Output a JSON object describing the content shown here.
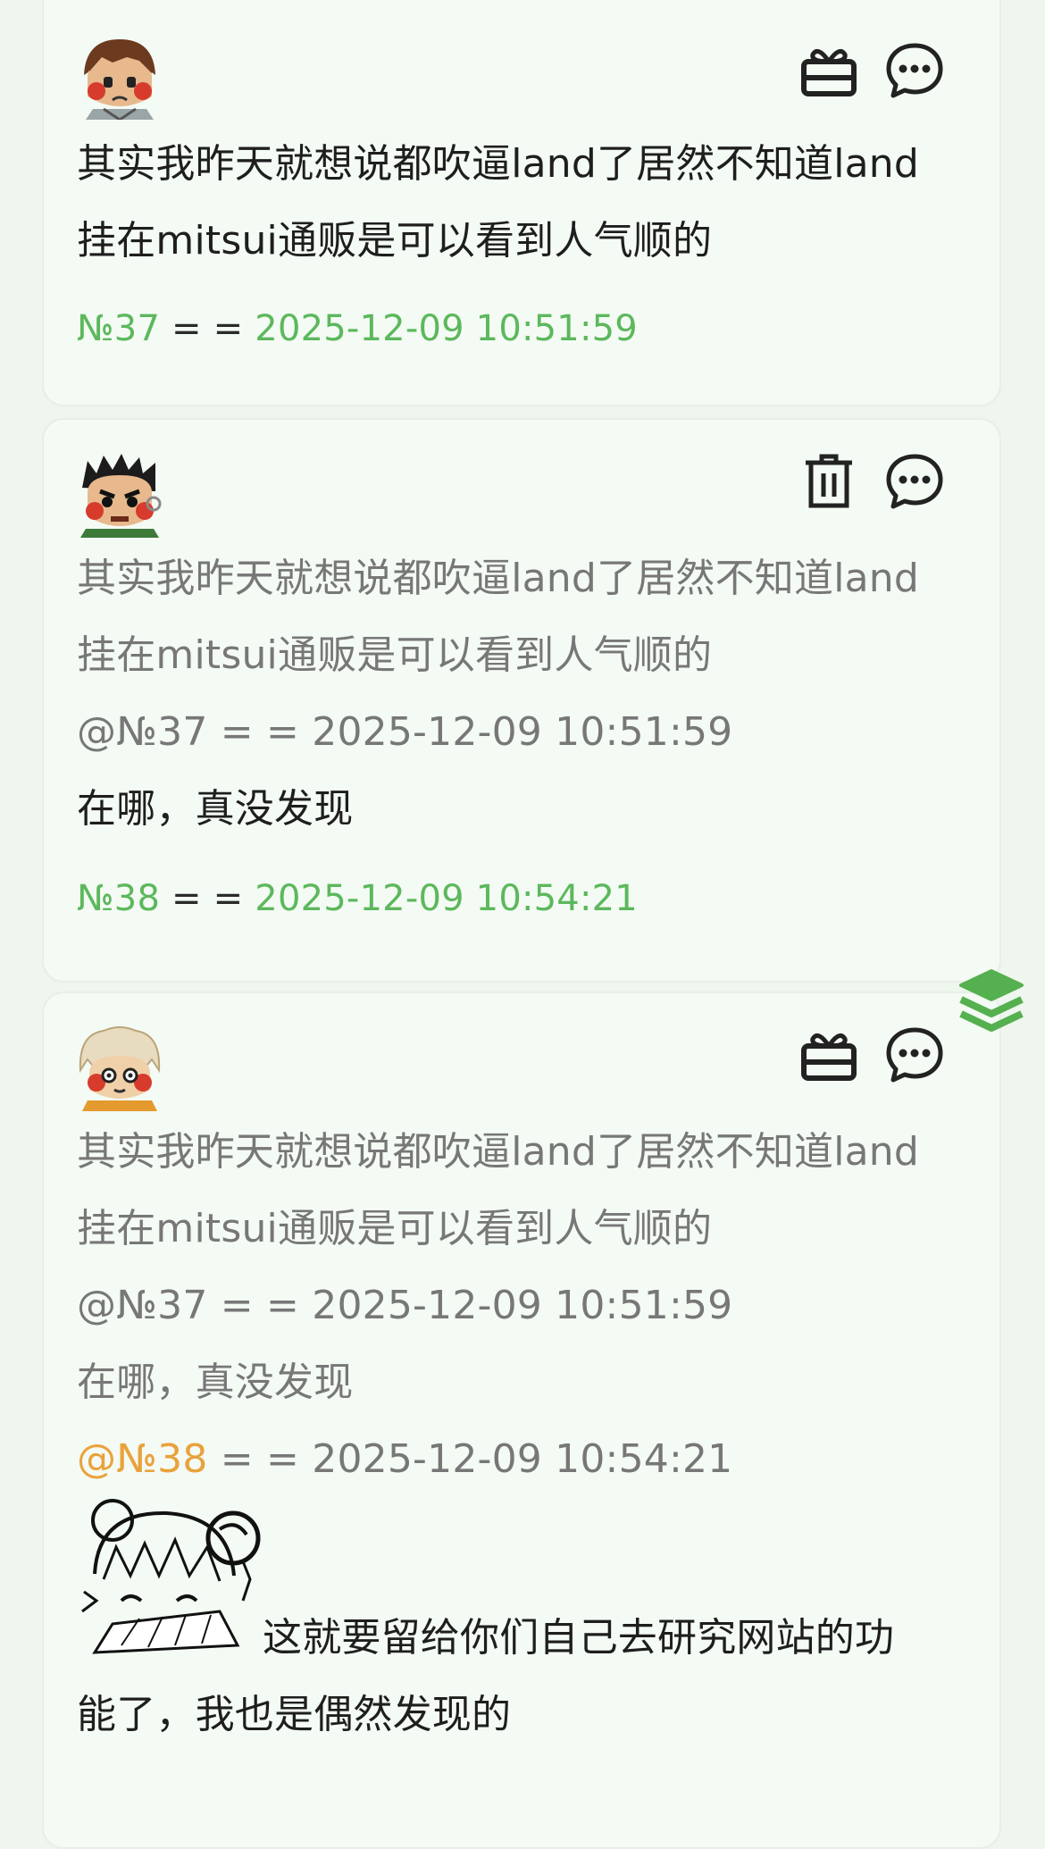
{
  "comments": [
    {
      "lines": [
        "其实我昨天就想说都吹逼land了居然不知道land",
        "挂在mitsui通贩是可以看到人气顺的"
      ],
      "footer": {
        "no": "№37",
        "sep": " = = ",
        "time": "2025-12-09 10:51:59"
      },
      "actions": {
        "first_icon": "gift-icon",
        "second_icon": "chat-bubble-icon"
      }
    },
    {
      "quote_lines": [
        "其实我昨天就想说都吹逼land了居然不知道land",
        "挂在mitsui通贩是可以看到人气顺的"
      ],
      "quote_ref": {
        "no": "@№37",
        "sep": " = = ",
        "time": "2025-12-09 10:51:59"
      },
      "body": "在哪，真没发现",
      "footer": {
        "no": "№38",
        "sep": " = = ",
        "time": "2025-12-09 10:54:21"
      },
      "actions": {
        "first_icon": "trash-icon",
        "second_icon": "chat-bubble-icon"
      }
    },
    {
      "quote_lines": [
        "其实我昨天就想说都吹逼land了居然不知道land",
        "挂在mitsui通贩是可以看到人气顺的"
      ],
      "quote_ref1": {
        "no": "@№37",
        "sep": " = = ",
        "time": "2025-12-09 10:51:59"
      },
      "quote_body": "在哪，真没发现",
      "quote_ref2": {
        "no": "@№38",
        "sep": " = = ",
        "time": "2025-12-09 10:54:21"
      },
      "body_lines": [
        "这就要留给你们自己去研究网站的功",
        "能了，我也是偶然发现的"
      ],
      "actions": {
        "first_icon": "gift-icon",
        "second_icon": "chat-bubble-icon"
      }
    }
  ],
  "fab_icon": "layers-icon",
  "colors": {
    "accent_green": "#5cb85c",
    "quote_orange": "#e9a23b",
    "background": "#eff6ee",
    "card": "#f4faf4"
  }
}
